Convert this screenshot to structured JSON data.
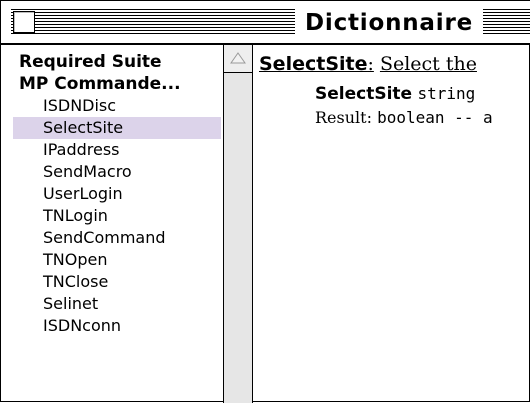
{
  "window": {
    "title": "Dictionnaire"
  },
  "sidebar": {
    "groups": [
      {
        "title": "Required Suite"
      },
      {
        "title": "MP Commande..."
      }
    ],
    "commands": [
      {
        "label": "ISDNDisc",
        "selected": false
      },
      {
        "label": "SelectSite",
        "selected": true
      },
      {
        "label": "IPaddress",
        "selected": false
      },
      {
        "label": "SendMacro",
        "selected": false
      },
      {
        "label": "UserLogin",
        "selected": false
      },
      {
        "label": "TNLogin",
        "selected": false
      },
      {
        "label": "SendCommand",
        "selected": false
      },
      {
        "label": "TNOpen",
        "selected": false
      },
      {
        "label": "TNClose",
        "selected": false
      },
      {
        "label": "Selinet",
        "selected": false
      },
      {
        "label": "ISDNconn",
        "selected": false
      }
    ]
  },
  "definition": {
    "name": "SelectSite",
    "separator": ":",
    "description": "Select the",
    "syntax_command": "SelectSite",
    "syntax_argument": "string",
    "result_label": "Result:",
    "result_value": "boolean -- a"
  },
  "colors": {
    "selection": "#dcd3ea",
    "scrollbar_track": "#e6e6e6"
  },
  "icons": {
    "close_box": "close-box-icon",
    "scroll_up": "triangle-up-icon"
  }
}
